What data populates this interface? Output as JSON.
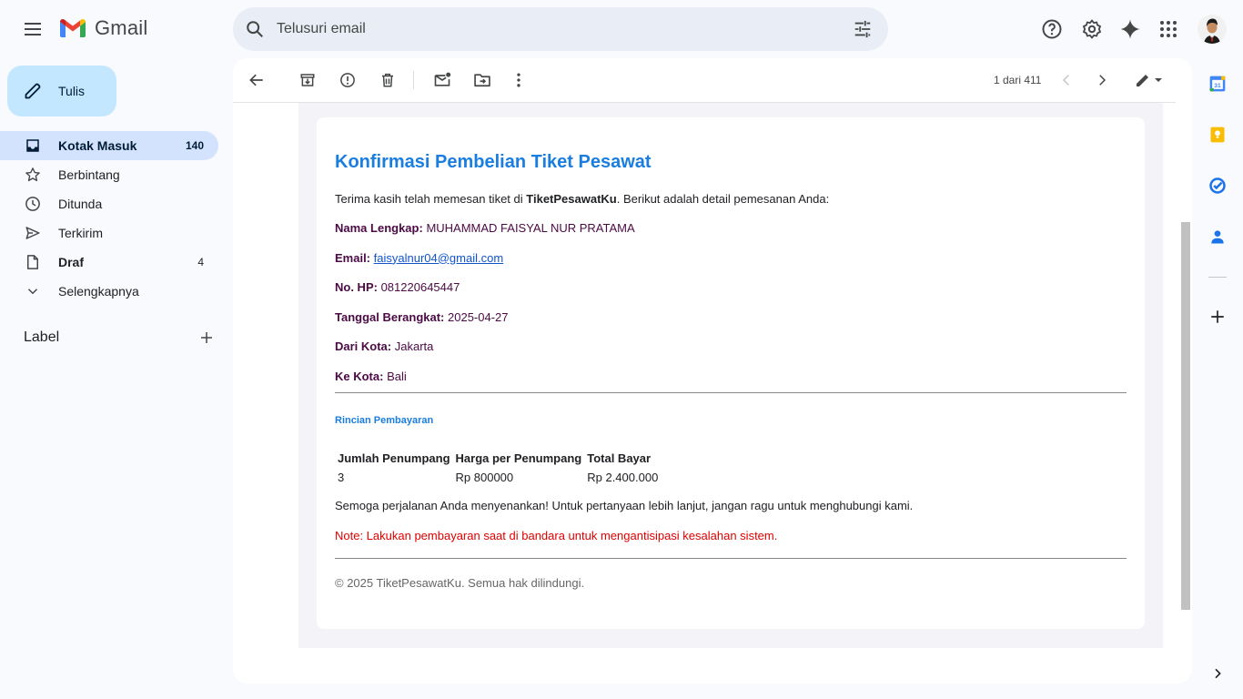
{
  "app": {
    "name": "Gmail",
    "menu_icon": "hamburger-menu-icon"
  },
  "search": {
    "placeholder": "Telusuri email"
  },
  "compose": {
    "label": "Tulis"
  },
  "nav": {
    "items": [
      {
        "label": "Kotak Masuk",
        "count": "140",
        "icon": "inbox-icon",
        "active": true
      },
      {
        "label": "Berbintang",
        "count": "",
        "icon": "star-icon"
      },
      {
        "label": "Ditunda",
        "count": "",
        "icon": "clock-icon"
      },
      {
        "label": "Terkirim",
        "count": "",
        "icon": "send-icon"
      },
      {
        "label": "Draf",
        "count": "4",
        "icon": "draft-icon",
        "bold": true
      },
      {
        "label": "Selengkapnya",
        "count": "",
        "icon": "chevron-down-icon"
      }
    ],
    "labels_heading": "Label"
  },
  "toolbar": {
    "pager": "1 dari 411"
  },
  "email": {
    "title": "Konfirmasi Pembelian Tiket Pesawat",
    "intro_before": "Terima kasih telah memesan tiket di ",
    "intro_brand": "TiketPesawatKu",
    "intro_after": ". Berikut adalah detail pemesanan Anda:",
    "fields": [
      {
        "label": "Nama Lengkap:",
        "value": "MUHAMMAD FAISYAL NUR PRATAMA"
      },
      {
        "label": "Email:",
        "value": "faisyalnur04@gmail.com",
        "link": true
      },
      {
        "label": "No. HP:",
        "value": "081220645447"
      },
      {
        "label": "Tanggal Berangkat:",
        "value": "2025-04-27"
      },
      {
        "label": "Dari Kota:",
        "value": "Jakarta"
      },
      {
        "label": "Ke Kota:",
        "value": "Bali"
      }
    ],
    "payment_heading": "Rincian Pembayaran",
    "table": {
      "headers": [
        "Jumlah Penumpang",
        "Harga per Penumpang",
        "Total Bayar"
      ],
      "row": [
        "3",
        "Rp 800000",
        "Rp 2.400.000"
      ]
    },
    "closing": "Semoga perjalanan Anda menyenankan! Untuk pertanyaan lebih lanjut, jangan ragu untuk menghubungi kami.",
    "note": "Note: Lakukan pembayaran saat di bandara untuk mengantisipasi kesalahan sistem.",
    "footer": "© 2025 TiketPesawatKu. Semua hak dilindungi."
  },
  "colors": {
    "accent": "#1a7de0",
    "field_label": "#4b0a44",
    "note": "#e00000",
    "active_nav": "#d3e3fd",
    "compose_bg": "#c2e7ff"
  }
}
